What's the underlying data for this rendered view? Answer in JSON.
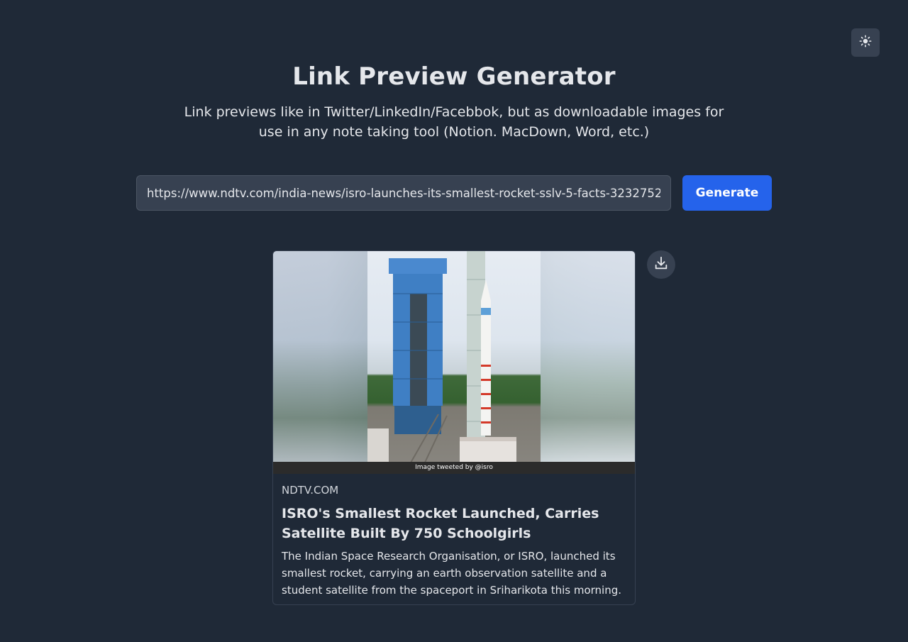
{
  "header": {
    "title": "Link Preview Generator",
    "subtitle": "Link previews like in Twitter/LinkedIn/Facebbok, but as downloadable images for use in any note taking tool (Notion. MacDown, Word, etc.)"
  },
  "form": {
    "url_value": "https://www.ndtv.com/india-news/isro-launches-its-smallest-rocket-sslv-5-facts-3232752",
    "generate_label": "Generate"
  },
  "preview": {
    "image_caption": "Image tweeted by @isro",
    "domain": "NDTV.COM",
    "title": "ISRO's Smallest Rocket Launched, Carries Satellite Built By 750 Schoolgirls",
    "description": "The Indian Space Research Organisation, or ISRO, launched its smallest rocket, carrying an earth observation satellite and a student satellite from the spaceport in Sriharikota this morning."
  },
  "icons": {
    "theme_toggle": "sun-icon",
    "download": "download-icon"
  },
  "colors": {
    "background": "#1f2937",
    "accent": "#2563eb",
    "input_bg": "#374151"
  }
}
